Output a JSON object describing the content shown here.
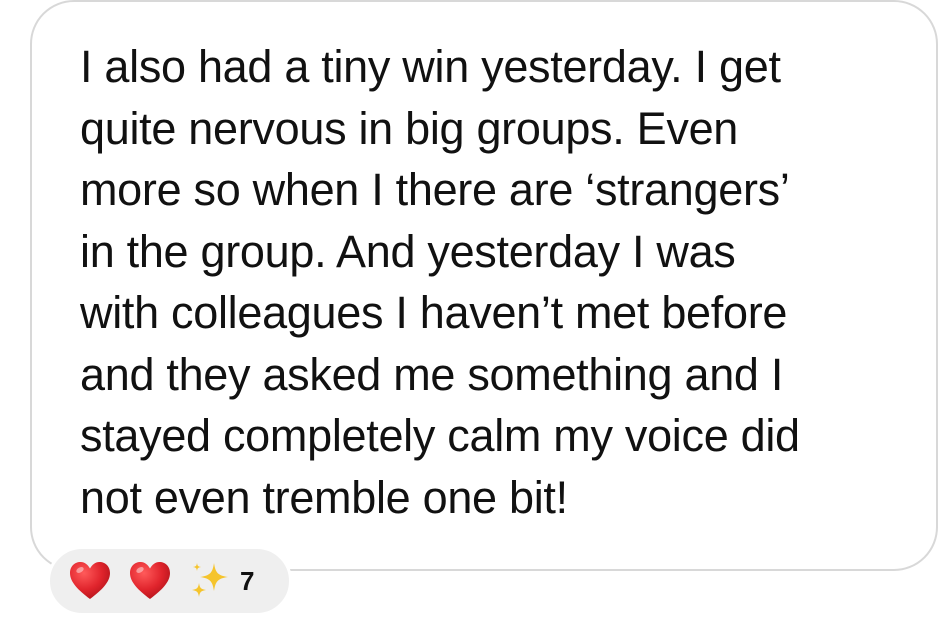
{
  "message": {
    "lines": [
      "I also had a tiny win yesterday. I get",
      "quite nervous in big groups. Even",
      "more so when I there are ‘strangers’",
      "in the group. And yesterday I was",
      "with colleagues I haven’t met before",
      "and they asked me something and I",
      "stayed completely calm my voice did",
      "not even tremble one bit!"
    ]
  },
  "reactions": {
    "icons": [
      "heart-icon",
      "heart-icon",
      "sparkles-icon"
    ],
    "count": "7",
    "heart_color": "#e0242c",
    "sparkle_color": "#f5c42c"
  },
  "colors": {
    "bubble_border": "#d8d8d8",
    "reaction_bg": "#efefef",
    "text": "#111111"
  }
}
